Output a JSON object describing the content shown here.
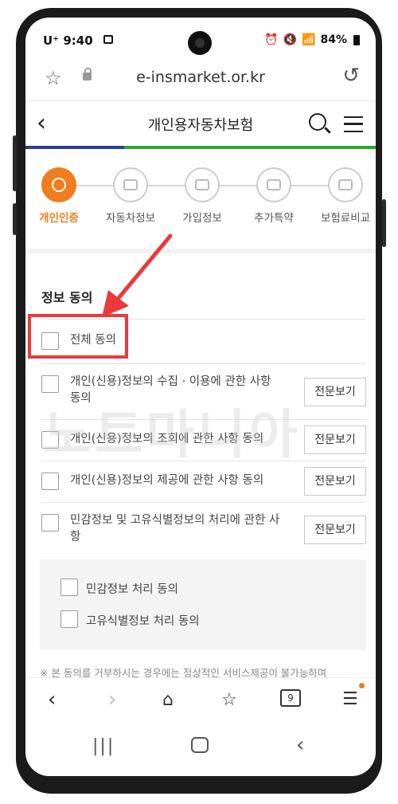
{
  "status_bar": {
    "carrier": "U⁺",
    "time": "9:40",
    "battery": "84%"
  },
  "url_bar": {
    "url": "e-insmarket.or.kr"
  },
  "header": {
    "title": "개인용자동차보험"
  },
  "steps": [
    {
      "label": "개인인증",
      "active": true
    },
    {
      "label": "자동차정보",
      "active": false
    },
    {
      "label": "가입정보",
      "active": false
    },
    {
      "label": "추가특약",
      "active": false
    },
    {
      "label": "보험료비교",
      "active": false
    }
  ],
  "consent": {
    "title": "정보 동의",
    "all_label": "전체 동의",
    "items": [
      {
        "label": "개인(신용)정보의 수집 · 이용에 관한 사항 동의",
        "button": "전문보기"
      },
      {
        "label": "개인(신용)정보의 조회에 관한 사항 동의",
        "button": "전문보기"
      },
      {
        "label": "개인(신용)정보의 제공에 관한 사항 동의",
        "button": "전문보기"
      },
      {
        "label": "민감정보 및 고유식별정보의 처리에 관한 사항",
        "button": "전문보기"
      }
    ],
    "sub_items": [
      {
        "label": "민감정보 처리 동의"
      },
      {
        "label": "고유식별정보 처리 동의"
      }
    ],
    "note": "※  본 동의를 거부하시는 경우에는 정상적인 서비스제공이 불가능하며"
  },
  "watermark": "노트마니아",
  "colors": {
    "accent": "#f07d1e",
    "progress_done": "#2a3d8f",
    "progress_rest": "#2fa82f",
    "highlight": "#ea3a3a"
  },
  "browser_nav": {
    "tabs_count": "9"
  }
}
